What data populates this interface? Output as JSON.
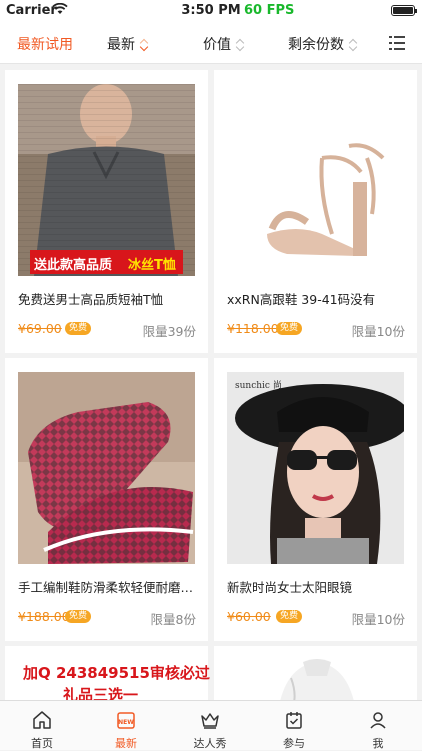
{
  "status": {
    "carrier": "Carrier",
    "time": "3:50 PM",
    "fps": "60 FPS"
  },
  "filters": [
    {
      "label": "最新试用",
      "active": true
    },
    {
      "label": "最新"
    },
    {
      "label": "价值"
    },
    {
      "label": "剩余份数"
    }
  ],
  "products": [
    {
      "title": "免费送男士高品质短袖T恤",
      "price": "¥69.00",
      "badge": "免费",
      "limit": "限量39份",
      "banner_text_1": "送此款高品质",
      "banner_text_2": "冰丝T恤"
    },
    {
      "title": "xxRN高跟鞋 39-41码没有",
      "price": "¥118.00",
      "badge": "免费",
      "limit": "限量10份"
    },
    {
      "title": "手工编制鞋防滑柔软轻便耐磨…",
      "price": "¥188.00",
      "badge": "免费",
      "limit": "限量8份"
    },
    {
      "title": "新款时尚女士太阳眼镜",
      "price": "¥60.00",
      "badge": "免费",
      "limit": "限量10份",
      "brand_text": "sunchic 尚"
    },
    {
      "promo_line_1": "加Q 243849515审核必过",
      "promo_line_2": "礼品三选一"
    },
    {}
  ],
  "tabs": [
    {
      "label": "首页",
      "icon": "home-icon"
    },
    {
      "label": "最新",
      "icon": "new-icon",
      "active": true
    },
    {
      "label": "达人秀",
      "icon": "crown-icon"
    },
    {
      "label": "参与",
      "icon": "calendar-check-icon"
    },
    {
      "label": "我",
      "icon": "user-icon"
    }
  ],
  "colors": {
    "accent": "#f15a24",
    "price": "#f08c1a",
    "badge": "#f6a623",
    "fps": "#19b82c"
  }
}
